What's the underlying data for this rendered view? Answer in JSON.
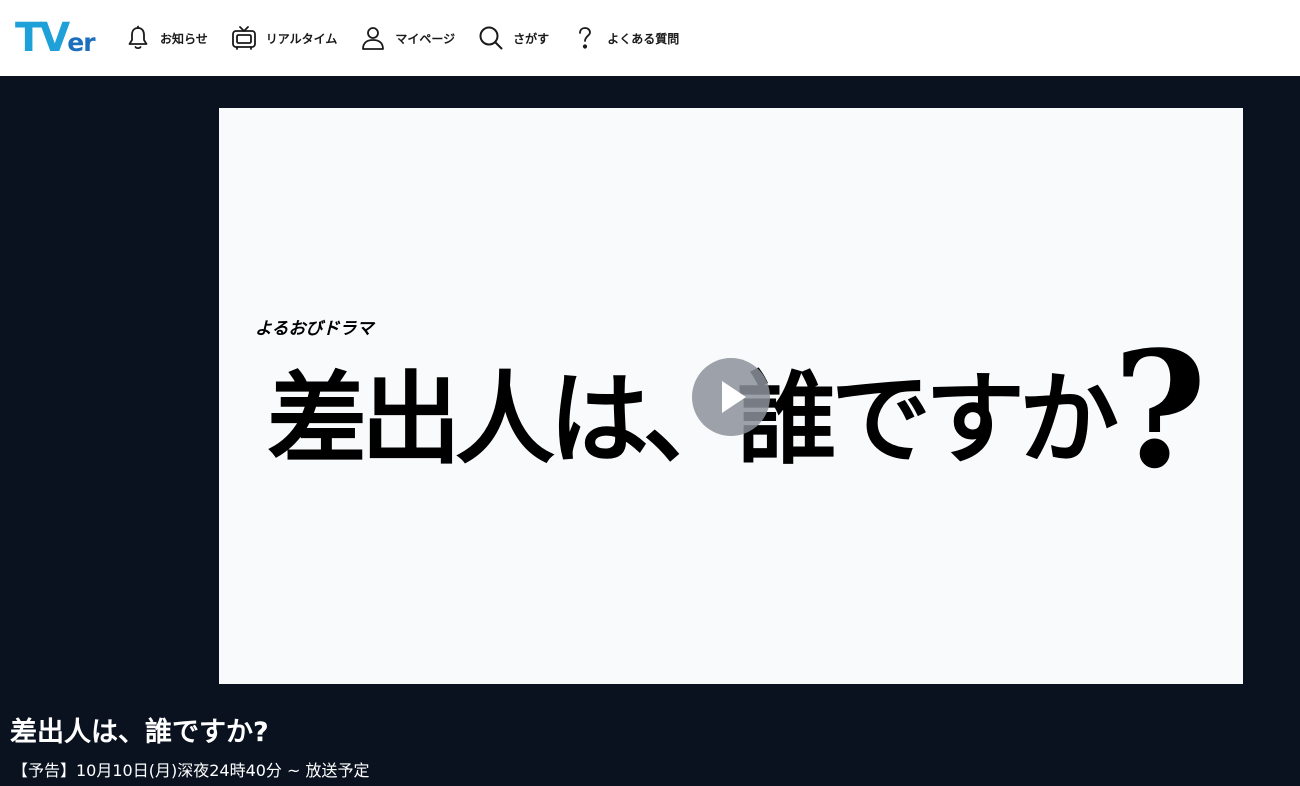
{
  "header": {
    "logo": {
      "main": "TV",
      "sub": "er"
    },
    "nav": [
      {
        "label": "お知らせ",
        "icon": "bell-icon"
      },
      {
        "label": "リアルタイム",
        "icon": "tv-icon"
      },
      {
        "label": "マイページ",
        "icon": "user-icon"
      },
      {
        "label": "さがす",
        "icon": "search-icon"
      },
      {
        "label": "よくある質問",
        "icon": "question-icon"
      }
    ]
  },
  "player": {
    "series_label": "よるおびドラマ",
    "title_art": "差出人は、誰ですか",
    "title_art_mark": "?"
  },
  "info": {
    "title": "差出人は、誰ですか?",
    "broadcast": "【予告】10月10日(月)深夜24時40分 ~ 放送予定"
  },
  "colors": {
    "page_bg": "#0a1220",
    "header_bg": "#ffffff",
    "logo_blue": "#1ea0d8",
    "player_bg": "#f9fafc"
  }
}
